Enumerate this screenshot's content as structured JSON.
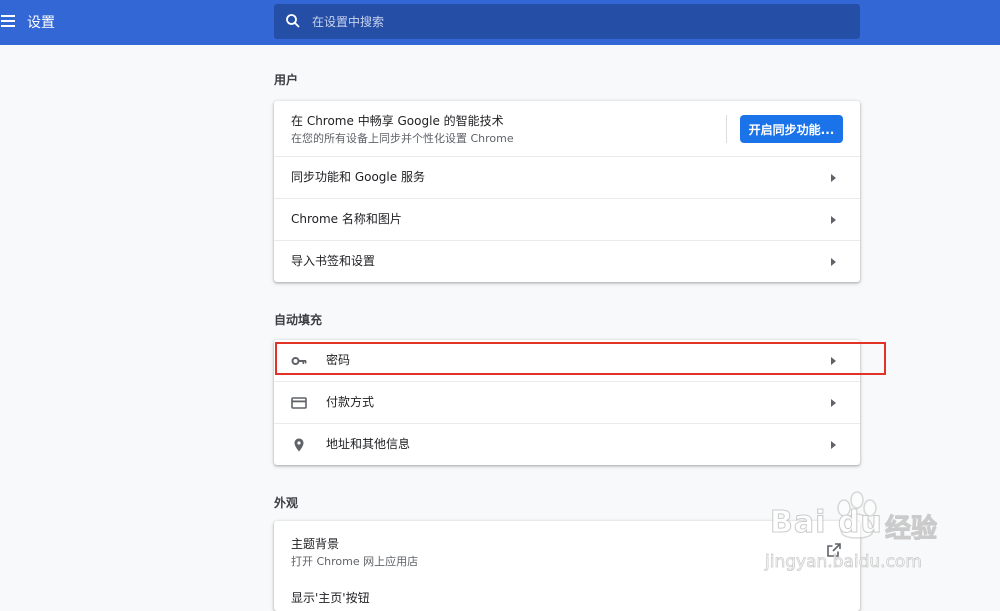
{
  "header": {
    "title": "设置",
    "search_placeholder": "在设置中搜索"
  },
  "sections": {
    "people": {
      "title": "用户",
      "sync_title": "在 Chrome 中畅享 Google 的智能技术",
      "sync_subtitle": "在您的所有设备上同步并个性化设置 Chrome",
      "sync_button": "开启同步功能...",
      "rows": [
        {
          "label": "同步功能和 Google 服务"
        },
        {
          "label": "Chrome 名称和图片"
        },
        {
          "label": "导入书签和设置"
        }
      ]
    },
    "autofill": {
      "title": "自动填充",
      "rows": [
        {
          "label": "密码",
          "icon": "key-icon"
        },
        {
          "label": "付款方式",
          "icon": "credit-card-icon"
        },
        {
          "label": "地址和其他信息",
          "icon": "location-pin-icon"
        }
      ]
    },
    "appearance": {
      "title": "外观",
      "theme_title": "主题背景",
      "theme_subtitle": "打开 Chrome 网上应用店",
      "cut_row": "显示'主页'按钮"
    }
  },
  "watermark": {
    "brand": "Bai du",
    "suffix": "经验",
    "url": "jingyan.baidu.com"
  },
  "colors": {
    "header_bg": "#3367d6",
    "search_bg": "#254ea6",
    "primary_button": "#1a73e8",
    "highlight_box": "#e23226"
  }
}
